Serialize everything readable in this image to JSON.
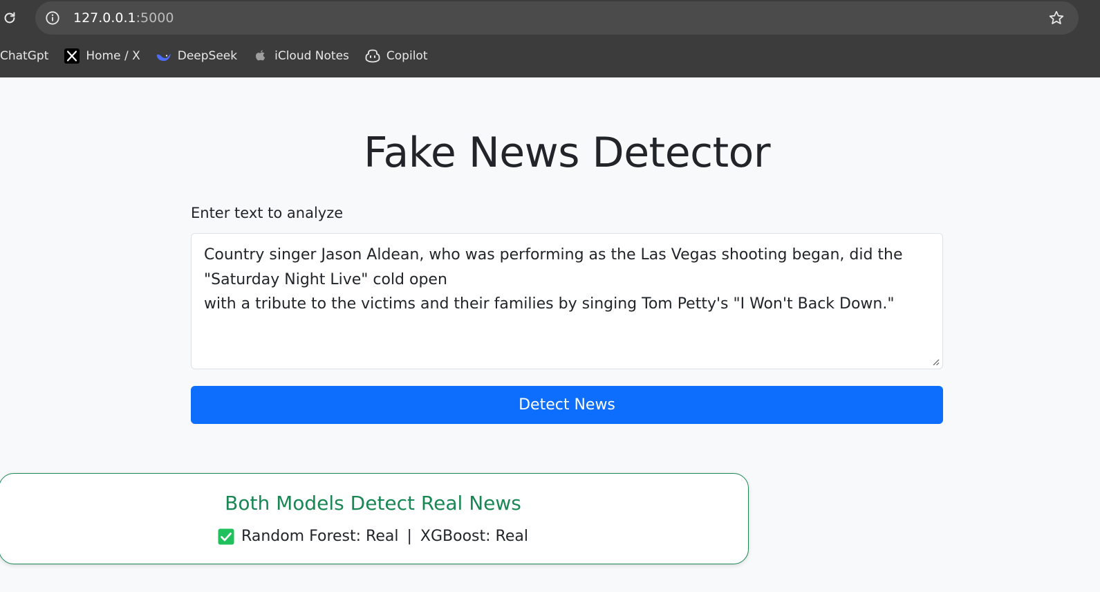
{
  "browser": {
    "url_host": "127.0.0.1",
    "url_port": ":5000",
    "bookmarks": [
      {
        "label": "ChatGpt",
        "icon": "none"
      },
      {
        "label": "Home / X",
        "icon": "x-logo-icon"
      },
      {
        "label": "DeepSeek",
        "icon": "deepseek-whale-icon"
      },
      {
        "label": "iCloud Notes",
        "icon": "apple-icon"
      },
      {
        "label": "Copilot",
        "icon": "copilot-icon"
      }
    ]
  },
  "page": {
    "title": "Fake News Detector",
    "input_label": "Enter text to analyze",
    "input_value": "Country singer Jason Aldean, who was performing as the Las Vegas shooting began, did the \"Saturday Night Live\" cold open\nwith a tribute to the victims and their families by singing Tom Petty's \"I Won't Back Down.\"",
    "detect_button": "Detect News"
  },
  "result": {
    "title": "Both Models Detect Real News",
    "rf_text": "Random Forest: Real",
    "separator": "|",
    "xgb_text": "XGBoost: Real",
    "status_icon": "green-check-icon"
  },
  "colors": {
    "primary": "#0d6efd",
    "success": "#198754",
    "check": "#20c05c",
    "chrome_bg": "#3c3c3c"
  }
}
